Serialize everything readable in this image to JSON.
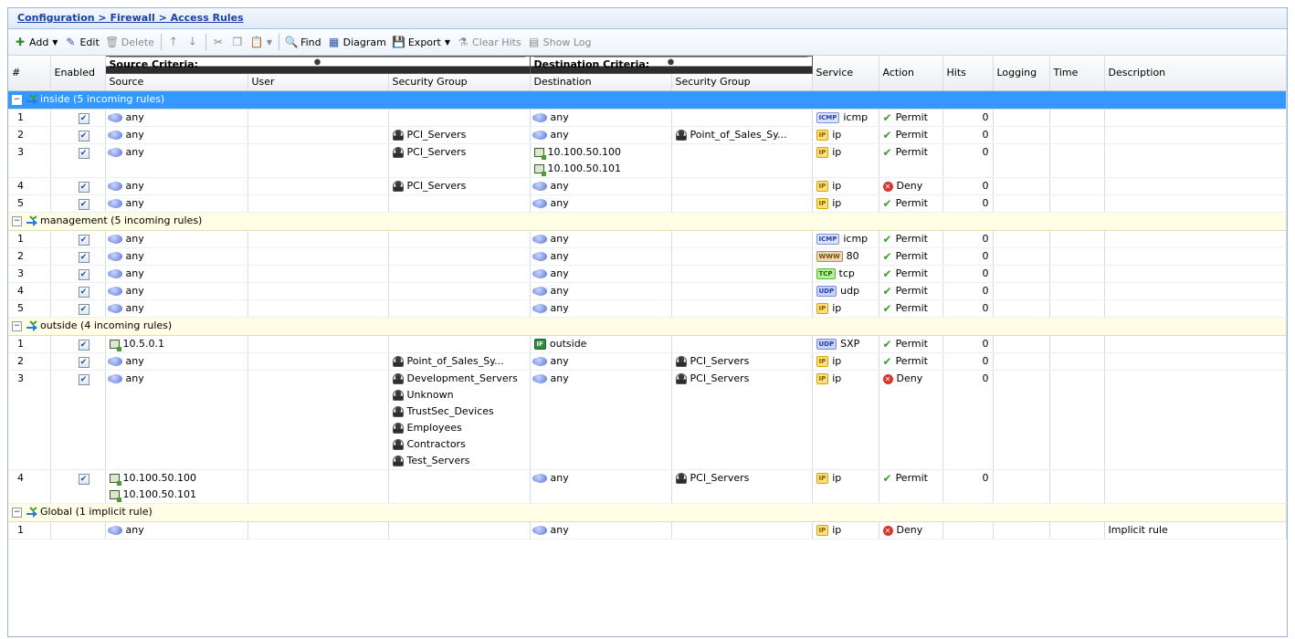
{
  "breadcrumb": "Configuration > Firewall > Access Rules",
  "toolbar": {
    "add": "Add",
    "edit": "Edit",
    "delete": "Delete",
    "find": "Find",
    "diagram": "Diagram",
    "export": "Export",
    "clear_hits": "Clear Hits",
    "show_log": "Show Log"
  },
  "headers": {
    "num": "#",
    "enabled": "Enabled",
    "source_criteria": "Source Criteria:",
    "destination_criteria": "Destination Criteria:",
    "source": "Source",
    "user": "User",
    "src_sg": "Security Group",
    "destination": "Destination",
    "dst_sg": "Security Group",
    "service": "Service",
    "action": "Action",
    "hits": "Hits",
    "logging": "Logging",
    "time": "Time",
    "description": "Description"
  },
  "colors": {
    "selected_group": "#3399ff",
    "group_bg": "#fffde5",
    "permit": "#3aa02a",
    "deny": "#d9342b",
    "link": "#1b3fa8"
  },
  "groups": [
    {
      "label": "inside (5 incoming rules)",
      "selected": true,
      "rules": [
        {
          "num": "1",
          "enabled": true,
          "source": [
            [
              "net",
              "any"
            ]
          ],
          "user": "",
          "src_sg": [],
          "dest": [
            [
              "net",
              "any"
            ]
          ],
          "dst_sg": [],
          "service": [
            "icmp",
            "icmp"
          ],
          "action": "Permit",
          "hits": "0",
          "desc": ""
        },
        {
          "num": "2",
          "enabled": true,
          "source": [
            [
              "net",
              "any"
            ]
          ],
          "user": "",
          "src_sg": [
            "PCI_Servers"
          ],
          "dest": [
            [
              "net",
              "any"
            ]
          ],
          "dst_sg": [
            "Point_of_Sales_Sy..."
          ],
          "service": [
            "ip",
            "ip"
          ],
          "action": "Permit",
          "hits": "0",
          "desc": ""
        },
        {
          "num": "3",
          "enabled": true,
          "source": [
            [
              "net",
              "any"
            ]
          ],
          "user": "",
          "src_sg": [
            "PCI_Servers"
          ],
          "dest": [
            [
              "host",
              "10.100.50.100"
            ],
            [
              "host",
              "10.100.50.101"
            ]
          ],
          "dst_sg": [],
          "service": [
            "ip",
            "ip"
          ],
          "action": "Permit",
          "hits": "0",
          "desc": ""
        },
        {
          "num": "4",
          "enabled": true,
          "source": [
            [
              "net",
              "any"
            ]
          ],
          "user": "",
          "src_sg": [
            "PCI_Servers"
          ],
          "dest": [
            [
              "net",
              "any"
            ]
          ],
          "dst_sg": [],
          "service": [
            "ip",
            "ip"
          ],
          "action": "Deny",
          "hits": "0",
          "desc": ""
        },
        {
          "num": "5",
          "enabled": true,
          "source": [
            [
              "net",
              "any"
            ]
          ],
          "user": "",
          "src_sg": [],
          "dest": [
            [
              "net",
              "any"
            ]
          ],
          "dst_sg": [],
          "service": [
            "ip",
            "ip"
          ],
          "action": "Permit",
          "hits": "0",
          "desc": ""
        }
      ]
    },
    {
      "label": "management (5 incoming rules)",
      "selected": false,
      "rules": [
        {
          "num": "1",
          "enabled": true,
          "source": [
            [
              "net",
              "any"
            ]
          ],
          "user": "",
          "src_sg": [],
          "dest": [
            [
              "net",
              "any"
            ]
          ],
          "dst_sg": [],
          "service": [
            "icmp",
            "icmp"
          ],
          "action": "Permit",
          "hits": "0",
          "desc": ""
        },
        {
          "num": "2",
          "enabled": true,
          "source": [
            [
              "net",
              "any"
            ]
          ],
          "user": "",
          "src_sg": [],
          "dest": [
            [
              "net",
              "any"
            ]
          ],
          "dst_sg": [],
          "service": [
            "http",
            "80"
          ],
          "action": "Permit",
          "hits": "0",
          "desc": ""
        },
        {
          "num": "3",
          "enabled": true,
          "source": [
            [
              "net",
              "any"
            ]
          ],
          "user": "",
          "src_sg": [],
          "dest": [
            [
              "net",
              "any"
            ]
          ],
          "dst_sg": [],
          "service": [
            "tcp",
            "tcp"
          ],
          "action": "Permit",
          "hits": "0",
          "desc": ""
        },
        {
          "num": "4",
          "enabled": true,
          "source": [
            [
              "net",
              "any"
            ]
          ],
          "user": "",
          "src_sg": [],
          "dest": [
            [
              "net",
              "any"
            ]
          ],
          "dst_sg": [],
          "service": [
            "udp",
            "udp"
          ],
          "action": "Permit",
          "hits": "0",
          "desc": ""
        },
        {
          "num": "5",
          "enabled": true,
          "source": [
            [
              "net",
              "any"
            ]
          ],
          "user": "",
          "src_sg": [],
          "dest": [
            [
              "net",
              "any"
            ]
          ],
          "dst_sg": [],
          "service": [
            "ip",
            "ip"
          ],
          "action": "Permit",
          "hits": "0",
          "desc": ""
        }
      ]
    },
    {
      "label": "outside (4 incoming rules)",
      "selected": false,
      "rules": [
        {
          "num": "1",
          "enabled": true,
          "source": [
            [
              "host",
              "10.5.0.1"
            ]
          ],
          "user": "",
          "src_sg": [],
          "dest": [
            [
              "if",
              "outside"
            ]
          ],
          "dst_sg": [],
          "service": [
            "udp",
            "SXP"
          ],
          "action": "Permit",
          "hits": "0",
          "desc": ""
        },
        {
          "num": "2",
          "enabled": true,
          "source": [
            [
              "net",
              "any"
            ]
          ],
          "user": "",
          "src_sg": [
            "Point_of_Sales_Sy..."
          ],
          "dest": [
            [
              "net",
              "any"
            ]
          ],
          "dst_sg": [
            "PCI_Servers"
          ],
          "service": [
            "ip",
            "ip"
          ],
          "action": "Permit",
          "hits": "0",
          "desc": ""
        },
        {
          "num": "3",
          "enabled": true,
          "source": [
            [
              "net",
              "any"
            ]
          ],
          "user": "",
          "src_sg": [
            "Development_Servers",
            "Unknown",
            "TrustSec_Devices",
            "Employees",
            "Contractors",
            "Test_Servers"
          ],
          "dest": [
            [
              "net",
              "any"
            ]
          ],
          "dst_sg": [
            "PCI_Servers"
          ],
          "service": [
            "ip",
            "ip"
          ],
          "action": "Deny",
          "hits": "0",
          "desc": ""
        },
        {
          "num": "4",
          "enabled": true,
          "source": [
            [
              "host",
              "10.100.50.100"
            ],
            [
              "host",
              "10.100.50.101"
            ]
          ],
          "user": "",
          "src_sg": [],
          "dest": [
            [
              "net",
              "any"
            ]
          ],
          "dst_sg": [
            "PCI_Servers"
          ],
          "service": [
            "ip",
            "ip"
          ],
          "action": "Permit",
          "hits": "0",
          "desc": ""
        }
      ]
    },
    {
      "label": "Global (1 implicit rule)",
      "selected": false,
      "rules": [
        {
          "num": "1",
          "enabled": false,
          "source": [
            [
              "net",
              "any"
            ]
          ],
          "user": "",
          "src_sg": [],
          "dest": [
            [
              "net",
              "any"
            ]
          ],
          "dst_sg": [],
          "service": [
            "ip",
            "ip"
          ],
          "action": "Deny",
          "hits": "",
          "desc": "Implicit rule"
        }
      ]
    }
  ]
}
